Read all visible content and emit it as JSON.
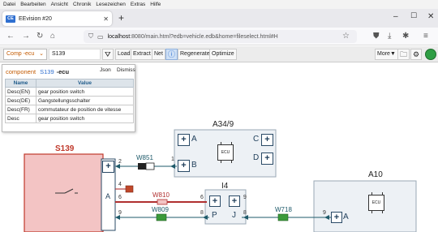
{
  "menubar": [
    "Datei",
    "Bearbeiten",
    "Ansicht",
    "Chronik",
    "Lesezeichen",
    "Extras",
    "Hilfe"
  ],
  "browser": {
    "tab_title": "EEvision #20",
    "favicon_text": "CE",
    "url_host": "localhost",
    "url_rest": ":8080/main.html?edb=vehicle.edb&home=fileselect.html#H"
  },
  "toolbar": {
    "comp_select": "Comp -ecu",
    "comp_value": "S139",
    "buttons": [
      "Load",
      "Extract",
      "Net"
    ],
    "regenerate": "Regenerate",
    "optimize": "Optimize",
    "more": "More"
  },
  "popup": {
    "kind": "component",
    "id": "S139",
    "tag": "-ecu",
    "json_link": "Json",
    "dismiss": "Dismiss",
    "columns": [
      "Name",
      "Value"
    ],
    "rows": [
      [
        "Desc(EN)",
        "gear position switch"
      ],
      [
        "Desc(DE)",
        "Gangstellungsschalter"
      ],
      [
        "Desc(FR)",
        "commutateur de position de vitesse"
      ],
      [
        "Desc",
        "gear position switch"
      ]
    ]
  },
  "diagram": {
    "components": {
      "s139": {
        "title": "S139",
        "connector": "A",
        "color": "#f3c4c4",
        "border": "#c0392b"
      },
      "a34": {
        "title": "A34/9",
        "ecu": "ECU",
        "pins": [
          "A",
          "B",
          "C",
          "D"
        ]
      },
      "i4": {
        "title": "I4",
        "pins": [
          "P",
          "J"
        ]
      },
      "a10": {
        "title": "A10",
        "ecu": "ECU",
        "pins": [
          "A"
        ]
      }
    },
    "wires": {
      "w851": "W851",
      "w810": "W810",
      "w809": "W809",
      "w718": "W718"
    },
    "pin_numbers": {
      "s139_2": "2",
      "s139_4": "4",
      "s139_6": "6",
      "s139_9": "9",
      "a34_b": "1",
      "i4_6": "6",
      "i4_8": "8",
      "i4_9": "9",
      "i4_8b": "8",
      "a10_9": "9"
    },
    "colors": {
      "red_wire": "#b03030",
      "green_marker": "#3a9a3a",
      "teal": "#1e5a6a"
    }
  }
}
